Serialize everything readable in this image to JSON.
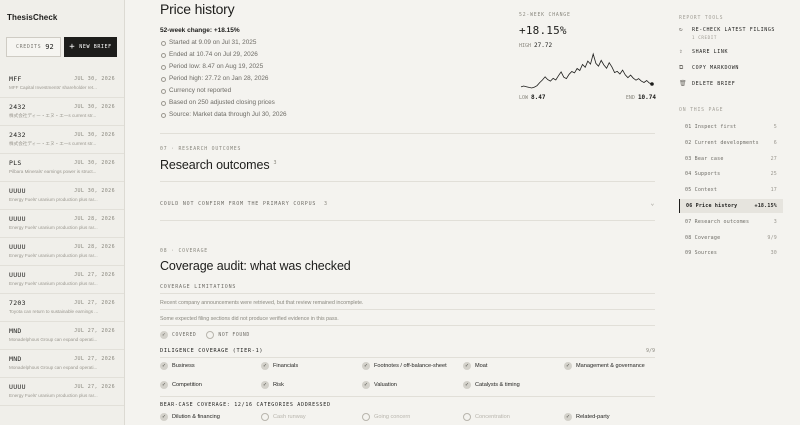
{
  "sidebar": {
    "brand": "ThesisCheck",
    "credits_label": "CREDITS",
    "credits_value": "92",
    "new_brief_label": "NEW BRIEF",
    "items": [
      {
        "ticker": "MFF",
        "date": "JUL 30, 2026",
        "summary": "MFF Capital Investments' shareholder ret..."
      },
      {
        "ticker": "2432",
        "date": "JUL 30, 2026",
        "summary": "株式会社ディー・エヌ・エーs current str..."
      },
      {
        "ticker": "2432",
        "date": "JUL 30, 2026",
        "summary": "株式会社ディー・エヌ・エーs current str..."
      },
      {
        "ticker": "PLS",
        "date": "JUL 30, 2026",
        "summary": "Pilbara Minerals' earnings power is struct..."
      },
      {
        "ticker": "UUUU",
        "date": "JUL 30, 2026",
        "summary": "Energy Fuels' uranium production plus rar..."
      },
      {
        "ticker": "UUUU",
        "date": "JUL 28, 2026",
        "summary": "Energy Fuels' uranium production plus rar..."
      },
      {
        "ticker": "UUUU",
        "date": "JUL 28, 2026",
        "summary": "Energy Fuels' uranium production plus rar..."
      },
      {
        "ticker": "UUUU",
        "date": "JUL 27, 2026",
        "summary": "Energy Fuels' uranium production plus rar..."
      },
      {
        "ticker": "7203",
        "date": "JUL 27, 2026",
        "summary": "Toyota can return to sustainable earnings ..."
      },
      {
        "ticker": "MND",
        "date": "JUL 27, 2026",
        "summary": "Monadelphous Group can expand operati..."
      },
      {
        "ticker": "MND",
        "date": "JUL 27, 2026",
        "summary": "Monadelphous Group can expand operati..."
      },
      {
        "ticker": "UUUU",
        "date": "JUL 27, 2026",
        "summary": "Energy Fuels' uranium production plus rar..."
      }
    ]
  },
  "main": {
    "title": "Price history",
    "change_line": "52-week change: +18.15%",
    "facts": [
      "Started at 9.09 on Jul 31, 2025",
      "Ended at 10.74 on Jul 29, 2026",
      "Period low: 8.47 on Aug 19, 2025",
      "Period high: 27.72 on Jan 28, 2026",
      "Currency not reported",
      "Based on 250 adjusted closing prices",
      "Source: Market data through Jul 30, 2026"
    ],
    "research": {
      "eyebrow": "07 · RESEARCH OUTCOMES",
      "title": "Research outcomes",
      "count": "3",
      "row_label": "COULD NOT CONFIRM FROM THE PRIMARY CORPUS",
      "row_count": "3"
    },
    "coverage": {
      "eyebrow": "08 · COVERAGE",
      "title": "Coverage audit: what was checked",
      "limitations_label": "COVERAGE LIMITATIONS",
      "limitations": [
        "Recent company announcements were retrieved, but that review remained incomplete.",
        "Some expected filing sections did not produce verified evidence in this pass."
      ],
      "legend_covered": "COVERED",
      "legend_not_found": "NOT FOUND",
      "diligence_label": "DILIGENCE COVERAGE (TIER-1)",
      "diligence_count": "9/9",
      "diligence_items": [
        {
          "label": "Business",
          "covered": true
        },
        {
          "label": "Financials",
          "covered": true
        },
        {
          "label": "Footnotes / off-balance-sheet",
          "covered": true
        },
        {
          "label": "Moat",
          "covered": true
        },
        {
          "label": "Management & governance",
          "covered": true
        },
        {
          "label": "Competition",
          "covered": true
        },
        {
          "label": "Risk",
          "covered": true
        },
        {
          "label": "Valuation",
          "covered": true
        },
        {
          "label": "Catalysts & timing",
          "covered": true
        }
      ],
      "bear_label": "BEAR-CASE COVERAGE: 12/16 CATEGORIES ADDRESSED",
      "bear_items": [
        {
          "label": "Dilution & financing",
          "covered": true
        },
        {
          "label": "Cash runway",
          "covered": false
        },
        {
          "label": "Going concern",
          "covered": false
        },
        {
          "label": "Concentration",
          "covered": false
        },
        {
          "label": "Related-party",
          "covered": true
        }
      ]
    }
  },
  "chart_data": {
    "type": "line",
    "eyebrow": "52-WEEK CHANGE",
    "headline": "+18.15%",
    "high_label": "HIGH",
    "high_value": "27.72",
    "low_label": "LOW",
    "low_value": "8.47",
    "end_label": "END",
    "end_value": "10.74",
    "ylim": [
      8.47,
      27.72
    ],
    "values": [
      9.09,
      9.6,
      9.2,
      8.8,
      8.47,
      9.0,
      9.8,
      11.5,
      13.0,
      14.8,
      13.2,
      12.4,
      13.9,
      13.0,
      15.4,
      17.6,
      14.6,
      13.8,
      16.2,
      17.8,
      17.0,
      19.5,
      18.4,
      21.8,
      20.2,
      23.7,
      22.0,
      27.72,
      22.4,
      20.8,
      24.1,
      21.5,
      19.6,
      22.8,
      20.4,
      17.2,
      17.9,
      16.4,
      18.6,
      15.9,
      14.3,
      15.8,
      14.0,
      12.9,
      13.8,
      12.4,
      11.6,
      12.7,
      11.3,
      10.74
    ],
    "line_color": "#1d1d1b"
  },
  "rail": {
    "tools_label": "REPORT TOOLS",
    "tools": [
      {
        "icon": "refresh-icon",
        "glyph": "↻",
        "label": "RE-CHECK LATEST FILINGS",
        "sub": "1 CREDIT"
      },
      {
        "icon": "share-icon",
        "glyph": "⇪",
        "label": "SHARE LINK",
        "sub": ""
      },
      {
        "icon": "copy-icon",
        "glyph": "⧉",
        "label": "COPY MARKDOWN",
        "sub": ""
      },
      {
        "icon": "trash-icon",
        "glyph": "🗑",
        "label": "DELETE BRIEF",
        "sub": ""
      }
    ],
    "page_label": "ON THIS PAGE",
    "sections": [
      {
        "label": "01 Inspect first",
        "count": "5"
      },
      {
        "label": "02 Current developments",
        "count": "6"
      },
      {
        "label": "03 Bear case",
        "count": "27"
      },
      {
        "label": "04 Supports",
        "count": "25"
      },
      {
        "label": "05 Context",
        "count": "17"
      },
      {
        "label": "06 Price history",
        "count": "+18.15%",
        "active": true
      },
      {
        "label": "07 Research outcomes",
        "count": "3"
      },
      {
        "label": "08 Coverage",
        "count": "9/9"
      },
      {
        "label": "09 Sources",
        "count": "30"
      }
    ]
  }
}
